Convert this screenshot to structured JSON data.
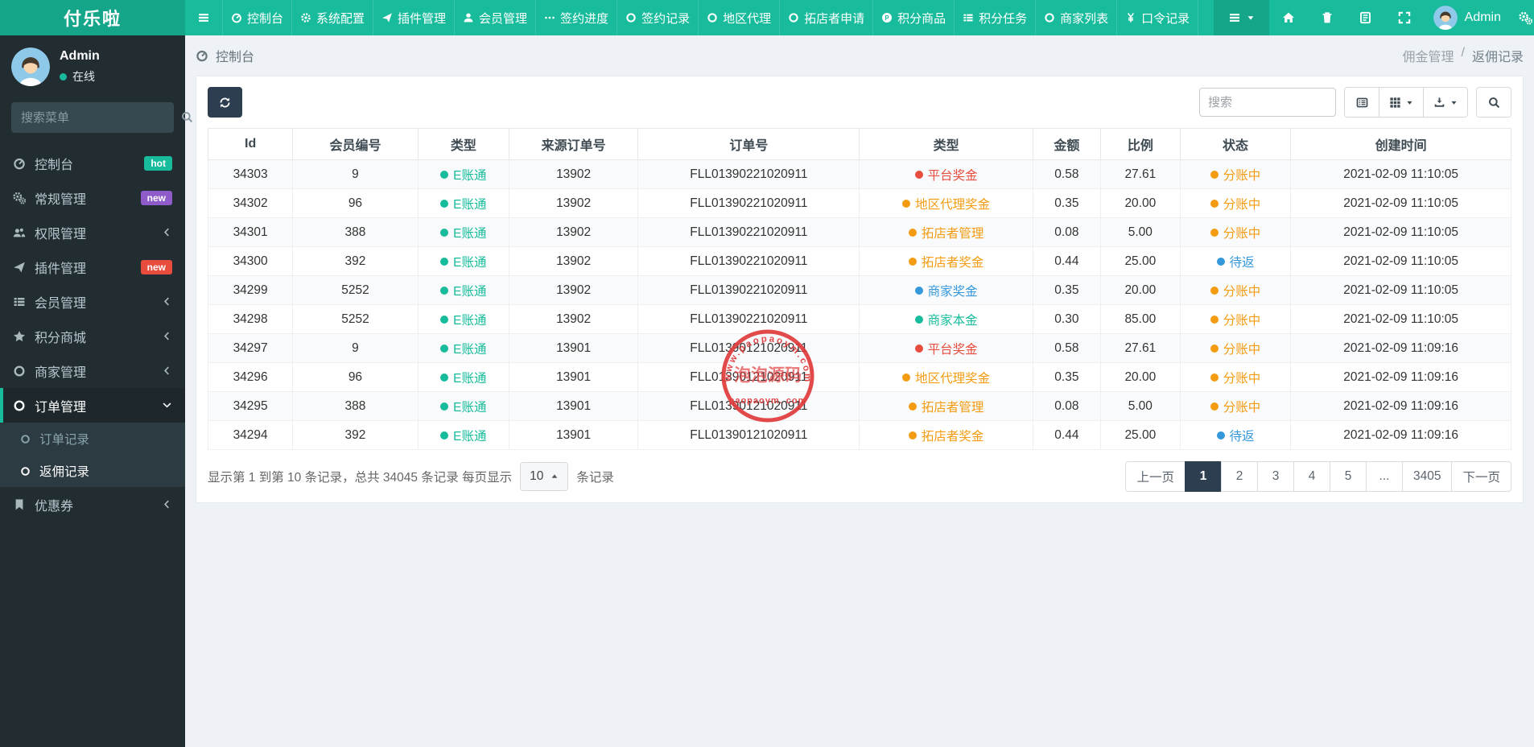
{
  "colors": {
    "accent_teal": "#18bc9c",
    "navy": "#2c3e50",
    "red": "#e74c3c",
    "orange": "#f39c12",
    "blue": "#3498db",
    "purple": "#8e5bc8"
  },
  "navbar": {
    "brand": "付乐啦",
    "items": [
      {
        "icon": "gauge",
        "label": "控制台"
      },
      {
        "icon": "cog",
        "label": "系统配置"
      },
      {
        "icon": "plane",
        "label": "插件管理"
      },
      {
        "icon": "user",
        "label": "会员管理"
      },
      {
        "icon": "ellipsis",
        "label": "签约进度"
      },
      {
        "icon": "circle",
        "label": "签约记录"
      },
      {
        "icon": "circle",
        "label": "地区代理"
      },
      {
        "icon": "circle",
        "label": "拓店者申请"
      },
      {
        "icon": "pcircle",
        "label": "积分商品"
      },
      {
        "icon": "thlist",
        "label": "积分任务"
      },
      {
        "icon": "circle",
        "label": "商家列表"
      },
      {
        "icon": "yen",
        "label": "口令记录"
      }
    ],
    "right_tools": [
      "home",
      "trash",
      "book",
      "expand"
    ],
    "user_name": "Admin"
  },
  "sidebar": {
    "user_name": "Admin",
    "user_status": "在线",
    "search_placeholder": "搜索菜单",
    "menu": [
      {
        "icon": "gauge",
        "label": "控制台",
        "badge": "hot",
        "badge_color": "#18bc9c"
      },
      {
        "icon": "cogs",
        "label": "常规管理",
        "badge": "new",
        "badge_color": "#8e5bc8"
      },
      {
        "icon": "users",
        "label": "权限管理",
        "chevron": "left"
      },
      {
        "icon": "plane",
        "label": "插件管理",
        "badge": "new",
        "badge_color": "#e74c3c"
      },
      {
        "icon": "thlist",
        "label": "会员管理",
        "chevron": "left"
      },
      {
        "icon": "star",
        "label": "积分商城",
        "chevron": "left"
      },
      {
        "icon": "circle",
        "label": "商家管理",
        "chevron": "left"
      },
      {
        "icon": "circle",
        "label": "订单管理",
        "chevron": "down",
        "active": true,
        "children": [
          {
            "label": "订单记录"
          },
          {
            "label": "返佣记录",
            "active": true
          }
        ]
      },
      {
        "icon": "bookmark",
        "label": "优惠券",
        "chevron": "left"
      }
    ]
  },
  "breadcrumb": {
    "page": "控制台",
    "parent": "佣金管理",
    "sep": "/",
    "current": "返佣记录"
  },
  "toolbar": {
    "search_placeholder": "搜索",
    "buttons": [
      {
        "icon": "listalt",
        "caret": false
      },
      {
        "icon": "th",
        "caret": true
      },
      {
        "icon": "export",
        "caret": true
      }
    ]
  },
  "table": {
    "columns": [
      "Id",
      "会员编号",
      "类型",
      "来源订单号",
      "订单号",
      "类型",
      "金额",
      "比例",
      "状态",
      "创建时间"
    ],
    "rows": [
      {
        "id": "34303",
        "member": "9",
        "account_type": "E账通",
        "account_color": "#18bc9c",
        "source_order": "13902",
        "order_no": "FLL01390221020911",
        "bonus_type": "平台奖金",
        "bonus_color": "#e74c3c",
        "amount": "0.58",
        "ratio": "27.61",
        "status": "分账中",
        "status_color": "#f39c12",
        "created": "2021-02-09 11:10:05"
      },
      {
        "id": "34302",
        "member": "96",
        "account_type": "E账通",
        "account_color": "#18bc9c",
        "source_order": "13902",
        "order_no": "FLL01390221020911",
        "bonus_type": "地区代理奖金",
        "bonus_color": "#f39c12",
        "amount": "0.35",
        "ratio": "20.00",
        "status": "分账中",
        "status_color": "#f39c12",
        "created": "2021-02-09 11:10:05"
      },
      {
        "id": "34301",
        "member": "388",
        "account_type": "E账通",
        "account_color": "#18bc9c",
        "source_order": "13902",
        "order_no": "FLL01390221020911",
        "bonus_type": "拓店者管理",
        "bonus_color": "#f39c12",
        "amount": "0.08",
        "ratio": "5.00",
        "status": "分账中",
        "status_color": "#f39c12",
        "created": "2021-02-09 11:10:05"
      },
      {
        "id": "34300",
        "member": "392",
        "account_type": "E账通",
        "account_color": "#18bc9c",
        "source_order": "13902",
        "order_no": "FLL01390221020911",
        "bonus_type": "拓店者奖金",
        "bonus_color": "#f39c12",
        "amount": "0.44",
        "ratio": "25.00",
        "status": "待返",
        "status_color": "#3498db",
        "created": "2021-02-09 11:10:05"
      },
      {
        "id": "34299",
        "member": "5252",
        "account_type": "E账通",
        "account_color": "#18bc9c",
        "source_order": "13902",
        "order_no": "FLL01390221020911",
        "bonus_type": "商家奖金",
        "bonus_color": "#3498db",
        "amount": "0.35",
        "ratio": "20.00",
        "status": "分账中",
        "status_color": "#f39c12",
        "created": "2021-02-09 11:10:05"
      },
      {
        "id": "34298",
        "member": "5252",
        "account_type": "E账通",
        "account_color": "#18bc9c",
        "source_order": "13902",
        "order_no": "FLL01390221020911",
        "bonus_type": "商家本金",
        "bonus_color": "#18bc9c",
        "amount": "0.30",
        "ratio": "85.00",
        "status": "分账中",
        "status_color": "#f39c12",
        "created": "2021-02-09 11:10:05"
      },
      {
        "id": "34297",
        "member": "9",
        "account_type": "E账通",
        "account_color": "#18bc9c",
        "source_order": "13901",
        "order_no": "FLL01390121020911",
        "bonus_type": "平台奖金",
        "bonus_color": "#e74c3c",
        "amount": "0.58",
        "ratio": "27.61",
        "status": "分账中",
        "status_color": "#f39c12",
        "created": "2021-02-09 11:09:16"
      },
      {
        "id": "34296",
        "member": "96",
        "account_type": "E账通",
        "account_color": "#18bc9c",
        "source_order": "13901",
        "order_no": "FLL01390121020911",
        "bonus_type": "地区代理奖金",
        "bonus_color": "#f39c12",
        "amount": "0.35",
        "ratio": "20.00",
        "status": "分账中",
        "status_color": "#f39c12",
        "created": "2021-02-09 11:09:16"
      },
      {
        "id": "34295",
        "member": "388",
        "account_type": "E账通",
        "account_color": "#18bc9c",
        "source_order": "13901",
        "order_no": "FLL01390121020911",
        "bonus_type": "拓店者管理",
        "bonus_color": "#f39c12",
        "amount": "0.08",
        "ratio": "5.00",
        "status": "分账中",
        "status_color": "#f39c12",
        "created": "2021-02-09 11:09:16"
      },
      {
        "id": "34294",
        "member": "392",
        "account_type": "E账通",
        "account_color": "#18bc9c",
        "source_order": "13901",
        "order_no": "FLL01390121020911",
        "bonus_type": "拓店者奖金",
        "bonus_color": "#f39c12",
        "amount": "0.44",
        "ratio": "25.00",
        "status": "待返",
        "status_color": "#3498db",
        "created": "2021-02-09 11:09:16"
      }
    ]
  },
  "footer": {
    "summary_before": "显示第 1 到第 10 条记录，总共 34045 条记录 每页显示",
    "page_size": "10",
    "summary_after": "条记录",
    "pages": [
      {
        "label": "上一页"
      },
      {
        "label": "1",
        "active": true
      },
      {
        "label": "2"
      },
      {
        "label": "3"
      },
      {
        "label": "4"
      },
      {
        "label": "5"
      },
      {
        "label": "..."
      },
      {
        "label": "3405"
      },
      {
        "label": "下一页"
      }
    ]
  },
  "watermark": {
    "arc_text": "www.paopaoym.com",
    "center_text": "泡泡源码",
    "bottom_text": "paopaoym. com"
  }
}
